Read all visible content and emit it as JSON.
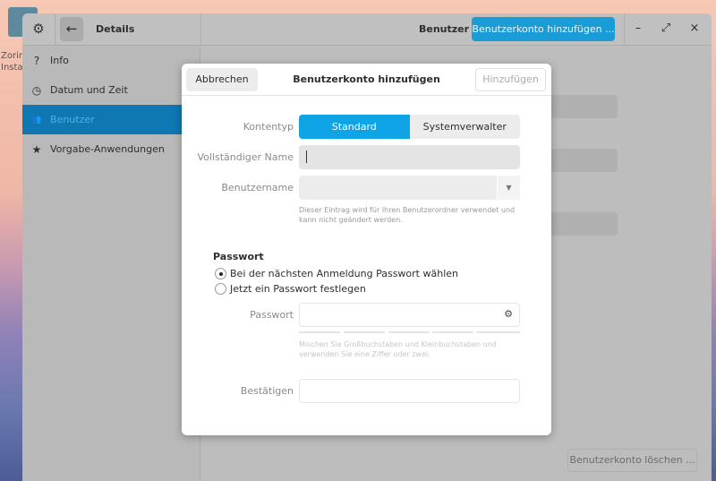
{
  "desktop": {
    "icon_label": "Zorin\nInsta"
  },
  "header": {
    "title": "Details",
    "section": "Benutzer",
    "add_user": "Benutzerkonto hinzufügen ...",
    "minimize": "–",
    "maximize": "⤢",
    "close": "×"
  },
  "sidebar": {
    "items": [
      {
        "label": "Info",
        "icon": "?"
      },
      {
        "label": "Datum und Zeit",
        "icon": "◷"
      },
      {
        "label": "Benutzer",
        "icon": "👥"
      },
      {
        "label": "Vorgabe-Anwendungen",
        "icon": "★"
      }
    ]
  },
  "main": {
    "delete_user": "Benutzerkonto löschen ..."
  },
  "dialog": {
    "cancel": "Abbrechen",
    "title": "Benutzerkonto hinzufügen",
    "add": "Hinzufügen",
    "account_type_label": "Kontentyp",
    "standard": "Standard",
    "admin": "Systemverwalter",
    "fullname_label": "Vollständiger Name",
    "fullname_value": "",
    "username_label": "Benutzername",
    "username_value": "",
    "username_hint": "Dieser Eintrag wird für Ihren Benutzerordner verwendet und kann nicht geändert werden.",
    "password_section": "Passwort",
    "radio_next_login": "Bei der nächsten Anmeldung Passwort wählen",
    "radio_set_now": "Jetzt ein Passwort festlegen",
    "password_label": "Passwort",
    "password_value": "",
    "password_hint": "Mischen Sie Großbuchstaben und Kleinbuchstaben und verwenden Sie eine Ziffer oder zwei.",
    "confirm_label": "Bestätigen",
    "confirm_value": ""
  }
}
